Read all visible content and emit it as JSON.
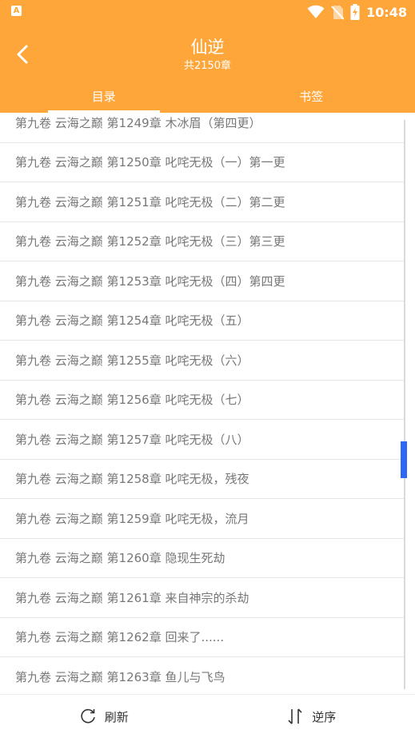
{
  "status_bar": {
    "app_icon_letter": "A",
    "time": "10:48",
    "icons": [
      "wifi-icon",
      "no-sim-icon",
      "battery-charging-icon"
    ]
  },
  "header": {
    "back_icon": "chevron-left-icon",
    "title": "仙逆",
    "subtitle": "共2150章",
    "background_color": "#FFA63A"
  },
  "tabs": [
    {
      "label": "目录",
      "active": true
    },
    {
      "label": "书签",
      "active": false
    }
  ],
  "chapters": [
    "第九卷 云海之巅 第1249章 木冰眉（第四更）",
    "第九卷 云海之巅 第1250章 叱咤无极（一）第一更",
    "第九卷 云海之巅 第1251章 叱咤无极（二）第二更",
    "第九卷 云海之巅 第1252章 叱咤无极（三）第三更",
    "第九卷 云海之巅 第1253章 叱咤无极（四）第四更",
    "第九卷 云海之巅 第1254章 叱咤无极（五）",
    "第九卷 云海之巅 第1255章 叱咤无极（六）",
    "第九卷 云海之巅 第1256章 叱咤无极（七）",
    "第九卷 云海之巅 第1257章 叱咤无极（八）",
    "第九卷 云海之巅 第1258章 叱咤无极，残夜",
    "第九卷 云海之巅 第1259章 叱咤无极，流月",
    "第九卷 云海之巅 第1260章 隐现生死劫",
    "第九卷 云海之巅 第1261章 来自神宗的杀劫",
    "第九卷 云海之巅 第1262章 回来了......",
    "第九卷 云海之巅 第1263章 鱼儿与飞鸟"
  ],
  "scrollbar": {
    "color": "#2F67F5"
  },
  "bottom_bar": {
    "refresh": {
      "icon": "refresh-icon",
      "label": "刷新"
    },
    "reverse": {
      "icon": "sort-reverse-icon",
      "label": "逆序"
    }
  }
}
